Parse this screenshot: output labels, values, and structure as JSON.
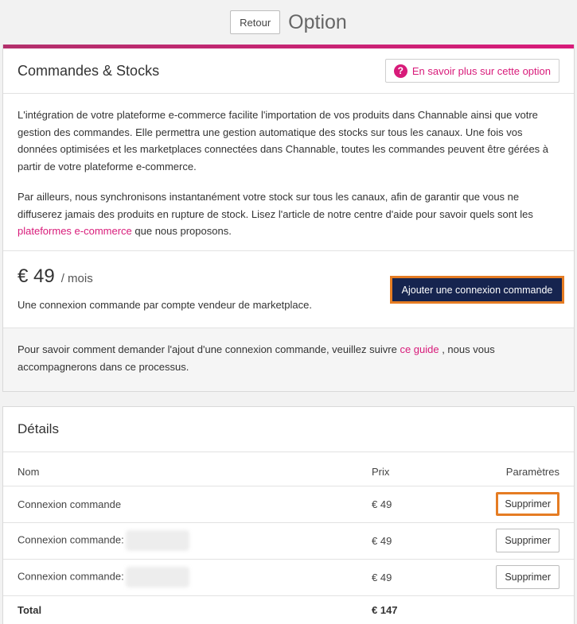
{
  "header": {
    "back_label": "Retour",
    "title": "Option"
  },
  "colors": {
    "accent": "#d81b7a",
    "primary_button": "#16244f",
    "highlight_outline": "#e57c23"
  },
  "option": {
    "title": "Commandes & Stocks",
    "learn_more_label": "En savoir plus sur cette option",
    "learn_more_icon": "question-circle-icon",
    "desc_p1": "L'intégration de votre plateforme e-commerce facilite l'importation de vos produits dans Channable ainsi que votre gestion des commandes. Elle permettra une gestion automatique des stocks sur tous les canaux. Une fois vos données optimisées et les marketplaces connectées dans Channable, toutes les commandes peuvent être gérées à partir de votre plateforme e-commerce.",
    "desc_p2_before": "Par ailleurs, nous synchronisons instantanément votre stock sur tous les canaux, afin de garantir que vous ne diffuserez jamais des produits en rupture de stock. Lisez l'article de notre centre d'aide pour savoir quels sont les ",
    "desc_p2_link": "plateformes e-commerce",
    "desc_p2_after": " que nous proposons.",
    "price": "€ 49",
    "price_unit": "/ mois",
    "price_note": "Une connexion commande par compte vendeur de marketplace.",
    "add_button": "Ajouter une connexion commande",
    "guide_before": "Pour savoir comment demander l'ajout d'une connexion commande, veuillez suivre ",
    "guide_link": "ce guide",
    "guide_after": " , nous vous accompagnerons dans ce processus."
  },
  "details": {
    "title": "Détails",
    "columns": {
      "name": "Nom",
      "price": "Prix",
      "params": "Paramètres"
    },
    "rows": [
      {
        "name": "Connexion commande",
        "price": "€ 49",
        "action": "Supprimer"
      },
      {
        "name": "Connexion commande:",
        "price": "€ 49",
        "action": "Supprimer"
      },
      {
        "name": "Connexion commande:",
        "price": "€ 49",
        "action": "Supprimer"
      }
    ],
    "total_label": "Total",
    "total_value": "€ 147"
  }
}
